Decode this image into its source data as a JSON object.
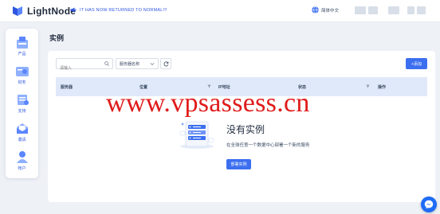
{
  "header": {
    "brand": "LightNode",
    "notice": "IT HAS NOW RETURNED TO NORMAL!!!",
    "language": "简体中文"
  },
  "sidebar": {
    "items": [
      {
        "label": "产品",
        "icon": "product-icon"
      },
      {
        "label": "财务",
        "icon": "finance-icon"
      },
      {
        "label": "支持",
        "icon": "support-icon"
      },
      {
        "label": "邀请",
        "icon": "invite-icon"
      },
      {
        "label": "帐户",
        "icon": "account-icon"
      }
    ]
  },
  "main": {
    "title": "实例",
    "search_placeholder": "请输入",
    "filter_select": "服务器名称",
    "add_button": "+添加",
    "table": {
      "columns": [
        "服务器",
        "位置",
        "IP地址",
        "状态",
        "操作"
      ]
    },
    "empty": {
      "title": "没有实例",
      "description": "在全球任意一个数据中心部署一个新的服务",
      "button": "部署实例"
    }
  },
  "watermark": "www.vpsassess.cn",
  "colors": {
    "accent": "#3c6ff0",
    "table_header": "#dfe9f9",
    "watermark": "#e01b1b",
    "background": "#eef1f6"
  }
}
